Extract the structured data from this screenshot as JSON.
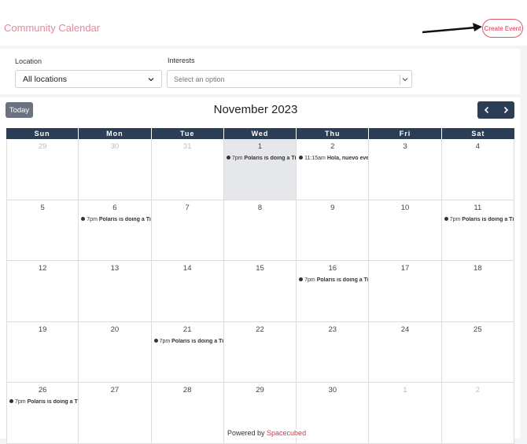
{
  "header": {
    "app_title": "Community Calendar",
    "create_label": "Create Event"
  },
  "filters": {
    "location_label": "Location",
    "location_value": "All locations",
    "interests_label": "Interests",
    "interests_placeholder": "Select an option"
  },
  "calendar": {
    "today_label": "Today",
    "month_title": "November 2023",
    "prev_icon": "chevron-left-icon",
    "next_icon": "chevron-right-icon",
    "weekdays": [
      "Sun",
      "Mon",
      "Tue",
      "Wed",
      "Thu",
      "Fri",
      "Sat"
    ],
    "weeks": [
      [
        {
          "day": "29",
          "other": true
        },
        {
          "day": "30",
          "other": true
        },
        {
          "day": "31",
          "other": true
        },
        {
          "day": "1",
          "today": true,
          "event": {
            "time": "7pm",
            "title": "Polaris is doing a Tiny Desk"
          }
        },
        {
          "day": "2",
          "event": {
            "time": "11:15am",
            "title": "Hola, nuevo evento"
          }
        },
        {
          "day": "3"
        },
        {
          "day": "4"
        }
      ],
      [
        {
          "day": "5"
        },
        {
          "day": "6",
          "event": {
            "time": "7pm",
            "title": "Polaris is doing a Tiny Desk"
          }
        },
        {
          "day": "7"
        },
        {
          "day": "8"
        },
        {
          "day": "9"
        },
        {
          "day": "10"
        },
        {
          "day": "11",
          "event": {
            "time": "7pm",
            "title": "Polaris is doing a Tiny Desk"
          }
        }
      ],
      [
        {
          "day": "12"
        },
        {
          "day": "13"
        },
        {
          "day": "14"
        },
        {
          "day": "15"
        },
        {
          "day": "16",
          "event": {
            "time": "7pm",
            "title": "Polaris is doing a Tiny Desk"
          }
        },
        {
          "day": "17"
        },
        {
          "day": "18"
        }
      ],
      [
        {
          "day": "19"
        },
        {
          "day": "20"
        },
        {
          "day": "21",
          "event": {
            "time": "7pm",
            "title": "Polaris is doing a Tiny Desk"
          }
        },
        {
          "day": "22"
        },
        {
          "day": "23"
        },
        {
          "day": "24"
        },
        {
          "day": "25"
        }
      ],
      [
        {
          "day": "26",
          "event": {
            "time": "7pm",
            "title": "Polaris is doing a Tiny Desk"
          }
        },
        {
          "day": "27"
        },
        {
          "day": "28"
        },
        {
          "day": "29"
        },
        {
          "day": "30"
        },
        {
          "day": "1",
          "other": true
        },
        {
          "day": "2",
          "other": true
        }
      ]
    ]
  },
  "footer": {
    "powered_prefix": "Powered by ",
    "powered_brand": "Spacecubed"
  }
}
